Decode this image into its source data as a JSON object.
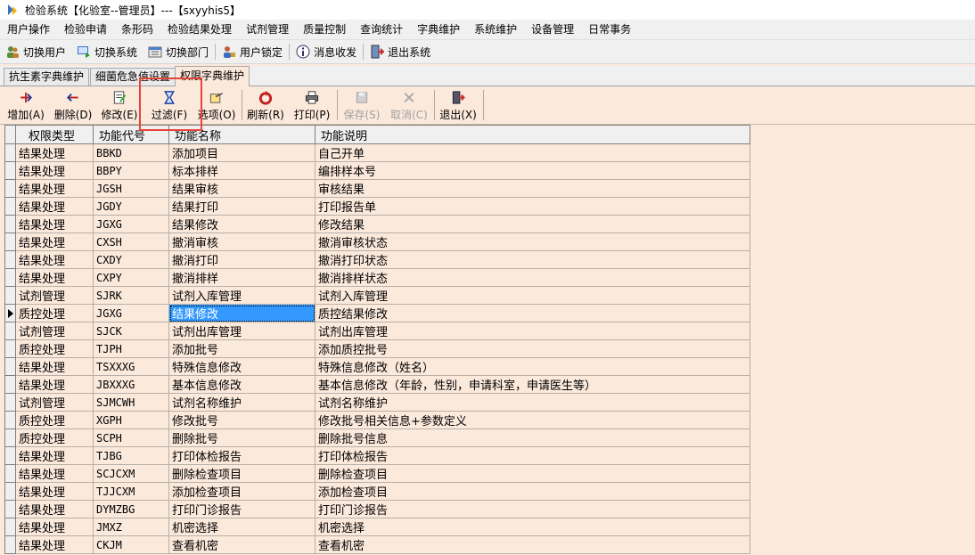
{
  "window": {
    "title": "检验系统【化验室--管理员】---【sxyyhis5】"
  },
  "menu": [
    "用户操作",
    "检验申请",
    "条形码",
    "检验结果处理",
    "试剂管理",
    "质量控制",
    "查询统计",
    "字典维护",
    "系统维护",
    "设备管理",
    "日常事务"
  ],
  "quickbar": [
    {
      "label": "切换用户",
      "icon": "switch-user-icon"
    },
    {
      "label": "切换系统",
      "icon": "switch-system-icon"
    },
    {
      "label": "切换部门",
      "icon": "switch-dept-icon"
    },
    {
      "label": "用户锁定",
      "icon": "lock-user-icon"
    },
    {
      "label": "消息收发",
      "icon": "message-icon"
    },
    {
      "label": "退出系统",
      "icon": "exit-system-icon"
    }
  ],
  "tabs": [
    "抗生素字典维护",
    "细菌危急值设置",
    "权限字典维护"
  ],
  "toolbar": [
    {
      "label": "增加(A)",
      "icon": "add-icon",
      "enabled": true
    },
    {
      "label": "删除(D)",
      "icon": "delete-icon",
      "enabled": true
    },
    {
      "label": "修改(E)",
      "icon": "edit-icon",
      "enabled": true
    },
    {
      "label": "过滤(F)",
      "icon": "filter-icon",
      "enabled": true
    },
    {
      "label": "选项(O)",
      "icon": "options-icon",
      "enabled": true
    },
    {
      "label": "刷新(R)",
      "icon": "refresh-icon",
      "enabled": true
    },
    {
      "label": "打印(P)",
      "icon": "print-icon",
      "enabled": true
    },
    {
      "label": "保存(S)",
      "icon": "save-icon",
      "enabled": false
    },
    {
      "label": "取消(C)",
      "icon": "cancel-icon",
      "enabled": false
    },
    {
      "label": "退出(X)",
      "icon": "exit-icon",
      "enabled": true
    }
  ],
  "grid": {
    "columns": [
      "权限类型",
      "功能代号",
      "功能名称",
      "功能说明"
    ],
    "selected_row": 9,
    "rows": [
      [
        "结果处理",
        "BBKD",
        "添加项目",
        "自己开单"
      ],
      [
        "结果处理",
        "BBPY",
        "标本排样",
        "编排样本号"
      ],
      [
        "结果处理",
        "JGSH",
        "结果审核",
        "审核结果"
      ],
      [
        "结果处理",
        "JGDY",
        "结果打印",
        "打印报告单"
      ],
      [
        "结果处理",
        "JGXG",
        "结果修改",
        "修改结果"
      ],
      [
        "结果处理",
        "CXSH",
        "撤消审核",
        "撤消审核状态"
      ],
      [
        "结果处理",
        "CXDY",
        "撤消打印",
        "撤消打印状态"
      ],
      [
        "结果处理",
        "CXPY",
        "撤消排样",
        "撤消排样状态"
      ],
      [
        "试剂管理",
        "SJRK",
        "试剂入库管理",
        "试剂入库管理"
      ],
      [
        "质控处理",
        "JGXG",
        "结果修改",
        "质控结果修改"
      ],
      [
        "试剂管理",
        "SJCK",
        "试剂出库管理",
        "试剂出库管理"
      ],
      [
        "质控处理",
        "TJPH",
        "添加批号",
        "添加质控批号"
      ],
      [
        "结果处理",
        "TSXXXG",
        "特殊信息修改",
        "特殊信息修改（姓名）"
      ],
      [
        "结果处理",
        "JBXXXG",
        "基本信息修改",
        "基本信息修改（年龄，性别，申请科室，申请医生等）"
      ],
      [
        "试剂管理",
        "SJMCWH",
        "试剂名称维护",
        "试剂名称维护"
      ],
      [
        "质控处理",
        "XGPH",
        "修改批号",
        "修改批号相关信息+参数定义"
      ],
      [
        "质控处理",
        "SCPH",
        "删除批号",
        "删除批号信息"
      ],
      [
        "结果处理",
        "TJBG",
        "打印体检报告",
        "打印体检报告"
      ],
      [
        "结果处理",
        "SCJCXM",
        "删除检查项目",
        "删除检查项目"
      ],
      [
        "结果处理",
        "TJJCXM",
        "添加检查项目",
        "添加检查项目"
      ],
      [
        "结果处理",
        "DYMZBG",
        "打印门诊报告",
        "打印门诊报告"
      ],
      [
        "结果处理",
        "JMXZ",
        "机密选择",
        "机密选择"
      ],
      [
        "结果处理",
        "CKJM",
        "查看机密",
        "查看机密"
      ]
    ]
  }
}
